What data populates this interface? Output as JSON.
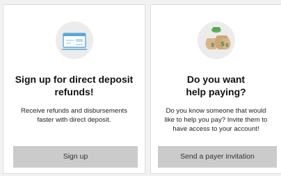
{
  "cards": [
    {
      "icon": "check-deposit-icon",
      "title_line1": "Sign up for direct deposit",
      "title_line2": "refunds!",
      "desc_line1": "Receive refunds and disbursements",
      "desc_line2": "faster with direct deposit.",
      "button_label": "Sign up"
    },
    {
      "icon": "money-bags-icon",
      "title_line1": "Do you want",
      "title_line2": "help paying?",
      "desc_line1": "Do you know someone that would",
      "desc_line2": "like to help you pay? Invite them to",
      "desc_line3": "have access to your account!",
      "button_label": "Send a payer invitation"
    }
  ],
  "colors": {
    "button_bg": "#cbcbcb",
    "icon_circle": "#ececec",
    "check_blue": "#5aa7d6",
    "money_green": "#6db86b",
    "bag_tan": "#d9b58a"
  }
}
